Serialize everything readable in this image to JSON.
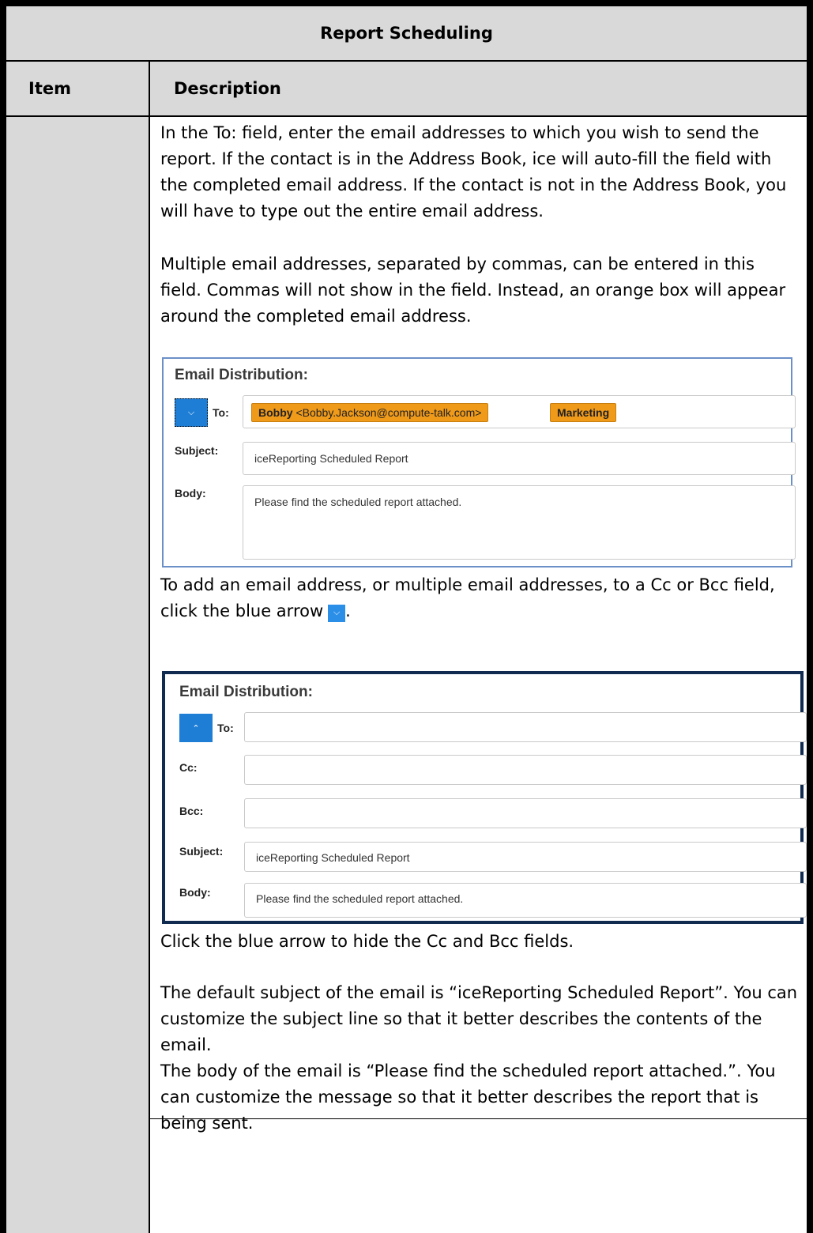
{
  "table": {
    "title": "Report Scheduling",
    "col_item": "Item",
    "col_description": "Description"
  },
  "description": {
    "p1": "In the To: field, enter the email addresses to which you wish to send the report. If the contact is in the Address Book, ice will auto-fill the field with the completed email address. If the contact is not in the Address Book, you will have to type out the entire email address.",
    "p2": "Multiple email addresses, separated by commas, can be entered in this field. Commas will not show in the field. Instead, an orange box will appear around the completed email address.",
    "p3_before": "To add an email address, or multiple email addresses, to a Cc or Bcc field, click the blue arrow",
    "p3_after": ".",
    "p4": "Click the blue arrow to hide the Cc and Bcc fields.",
    "p5": "The default subject of the email is “iceReporting Scheduled Report”. You can customize the subject line so that it better describes the contents of the email.",
    "p6": "The body of the email is “Please find the scheduled report attached.”. You can customize the message so that it better describes the report that is being sent."
  },
  "screenshot1": {
    "title": "Email Distribution:",
    "to_label": "To:",
    "chip1_name": "Bobby",
    "chip1_email": "<Bobby.Jackson@compute-talk.com>",
    "chip2": "Marketing",
    "subject_label": "Subject:",
    "subject_value": "iceReporting Scheduled Report",
    "body_label": "Body:",
    "body_value": "Please find the scheduled report attached.",
    "arrow_icon": "chevron-down-icon"
  },
  "screenshot2": {
    "title": "Email Distribution:",
    "to_label": "To:",
    "cc_label": "Cc:",
    "bcc_label": "Bcc:",
    "subject_label": "Subject:",
    "subject_value": "iceReporting Scheduled Report",
    "body_label": "Body:",
    "body_value": "Please find the scheduled report attached.",
    "arrow_icon": "chevron-up-icon"
  },
  "colors": {
    "header_bg": "#d9d9d9",
    "arrow_blue": "#1e7ed6",
    "chip_orange": "#f09a1a"
  }
}
